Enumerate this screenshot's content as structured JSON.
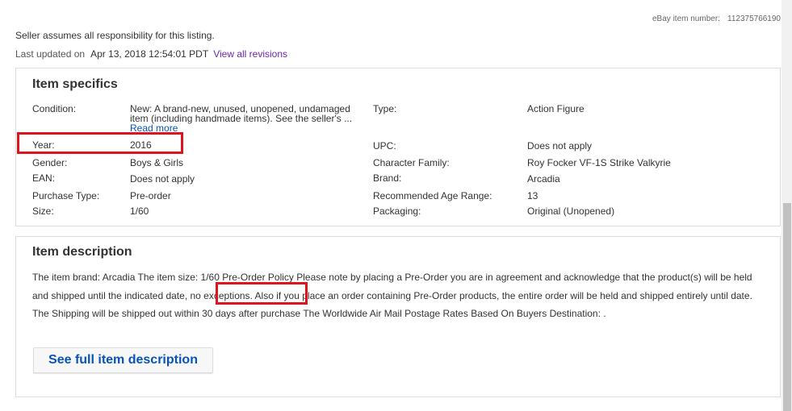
{
  "header": {
    "item_number_label": "eBay item number:",
    "item_number_value": "112375766190",
    "seller_note": "Seller assumes all responsibility for this listing.",
    "last_updated_label": "Last updated on",
    "last_updated_value": "Apr 13, 2018 12:54:01 PDT",
    "revisions_link": "View all revisions"
  },
  "specifics": {
    "title": "Item specifics",
    "condition_label": "Condition:",
    "condition_value": "New: A brand-new, unused, unopened, undamaged item (including handmade items). See the seller's ...",
    "read_more": "Read more",
    "year_label": "Year:",
    "year_value": "2016",
    "gender_label": "Gender:",
    "gender_value": "Boys & Girls",
    "ean_label": "EAN:",
    "ean_value": "Does not apply",
    "purchase_type_label": "Purchase Type:",
    "purchase_type_value": "Pre-order",
    "size_label": "Size:",
    "size_value": "1/60",
    "type_label": "Type:",
    "type_value": "Action Figure",
    "upc_label": "UPC:",
    "upc_value": "Does not apply",
    "character_family_label": "Character Family:",
    "character_family_value": "Roy Focker VF-1S Strike Valkyrie",
    "brand_label": "Brand:",
    "brand_value": "Arcadia",
    "age_range_label": "Recommended Age Range:",
    "age_range_value": "13",
    "packaging_label": "Packaging:",
    "packaging_value": "Original (Unopened)"
  },
  "description": {
    "title": "Item description",
    "text_before": "The item brand: Arcadia  The item size: 1/60      Pre-Order Policy Please note by placing a Pre-Order you are in agreement and acknowledge that the product(s) will be held and shipped until ",
    "text_highlight": "the indicated date,",
    "text_after": " no exceptions.  Also if you place an order containing Pre-Order products, the entire order will be held and shipped entirely until date. The Shipping will be shipped out within 30 days after purchase          The Worldwide  Air Mail Postage Rates  Based On Buyers Destination:       .",
    "see_full_button": "See full item description"
  },
  "colors": {
    "link_blue": "#0654ba",
    "link_purple": "#6b24b2",
    "highlight_red": "#e0141e",
    "text": "#333333",
    "border": "#dddddd"
  }
}
